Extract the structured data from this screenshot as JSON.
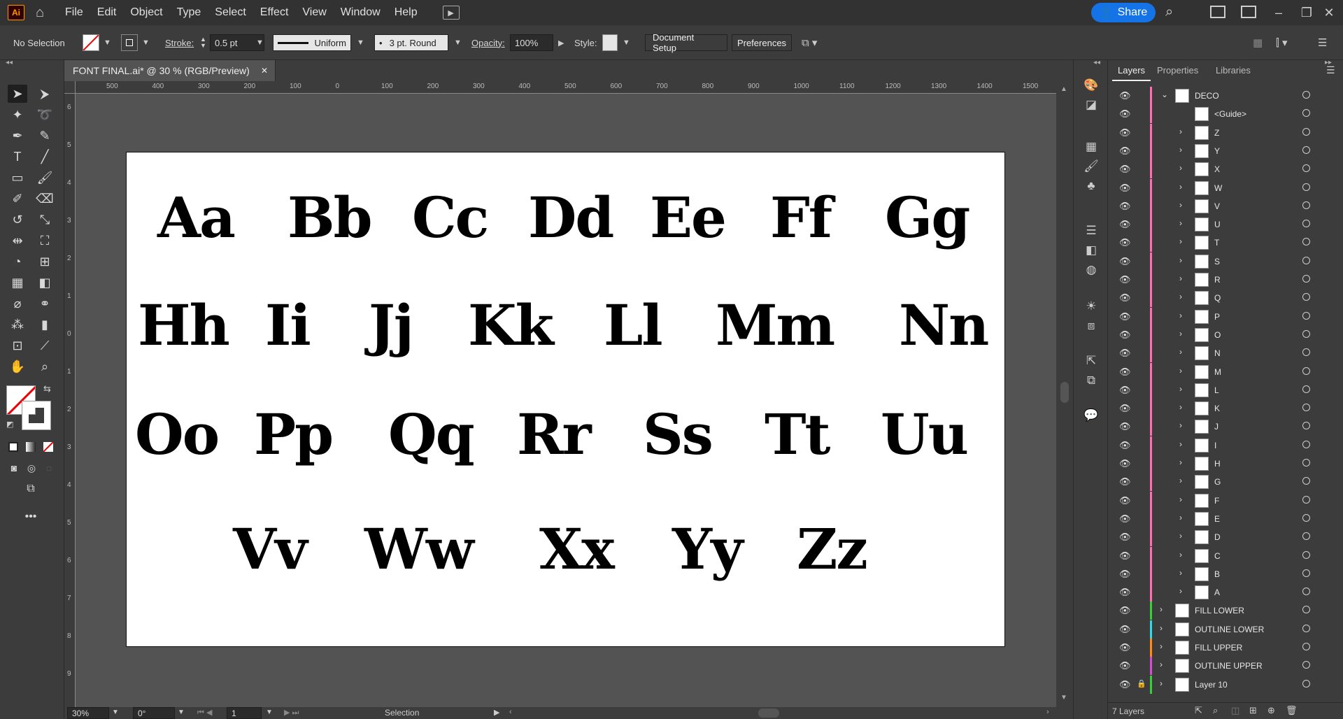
{
  "app": {
    "logo": "Ai",
    "menus": [
      "File",
      "Edit",
      "Object",
      "Type",
      "Select",
      "Effect",
      "View",
      "Window",
      "Help"
    ],
    "share_label": "Share"
  },
  "control_bar": {
    "selection": "No Selection",
    "stroke_label": "Stroke:",
    "stroke_value": "0.5 pt",
    "profile": "Uniform",
    "brush": "3 pt. Round",
    "opacity_label": "Opacity:",
    "opacity_value": "100%",
    "style_label": "Style:",
    "document_setup": "Document Setup",
    "preferences": "Preferences"
  },
  "document": {
    "tab_title": "FONT FINAL.ai* @ 30 % (RGB/Preview)",
    "close": "✕"
  },
  "ruler": {
    "h_ticks": [
      "500",
      "400",
      "300",
      "200",
      "100",
      "0",
      "100",
      "200",
      "300",
      "400",
      "500",
      "600",
      "700",
      "800",
      "900",
      "1000",
      "1100",
      "1200",
      "1300",
      "1400",
      "1500"
    ],
    "v_ticks": [
      "6",
      "5",
      "4",
      "3",
      "2",
      "1",
      "0",
      "1",
      "2",
      "3",
      "4",
      "5",
      "6",
      "7",
      "8",
      "9"
    ]
  },
  "artboard": {
    "row1": [
      "Aa",
      "Bb",
      "Cc",
      "Dd",
      "Ee",
      "Ff",
      "Gg"
    ],
    "row2": [
      "Hh",
      "Ii",
      "Jj",
      "Kk",
      "Ll",
      "Mm",
      "Nn"
    ],
    "row3": [
      "Oo",
      "Pp",
      "Qq",
      "Rr",
      "Ss",
      "Tt",
      "Uu"
    ],
    "row4": [
      "Vv",
      "Ww",
      "Xx",
      "Yy",
      "Zz"
    ]
  },
  "status": {
    "zoom": "30%",
    "rotation": "0°",
    "artboard_num": "1",
    "tool": "Selection"
  },
  "layers_panel": {
    "tabs": [
      "Layers",
      "Properties",
      "Libraries"
    ],
    "deco": "DECO",
    "guide": "<Guide>",
    "letters": [
      "Z",
      "Y",
      "X",
      "W",
      "V",
      "U",
      "T",
      "S",
      "R",
      "Q",
      "P",
      "O",
      "N",
      "M",
      "L",
      "K",
      "J",
      "I",
      "H",
      "G",
      "F",
      "E",
      "D",
      "C",
      "B",
      "A"
    ],
    "others": [
      {
        "name": "FILL LOWER",
        "color": "#3bcc3b"
      },
      {
        "name": "OUTLINE LOWER",
        "color": "#37d8e6"
      },
      {
        "name": "FILL UPPER",
        "color": "#ff8c1a"
      },
      {
        "name": "OUTLINE UPPER",
        "color": "#d14fd1"
      },
      {
        "name": "Layer 10",
        "color": "#3bcc3b"
      }
    ],
    "deco_color": "#ff6fb0",
    "footer": "7 Layers"
  }
}
